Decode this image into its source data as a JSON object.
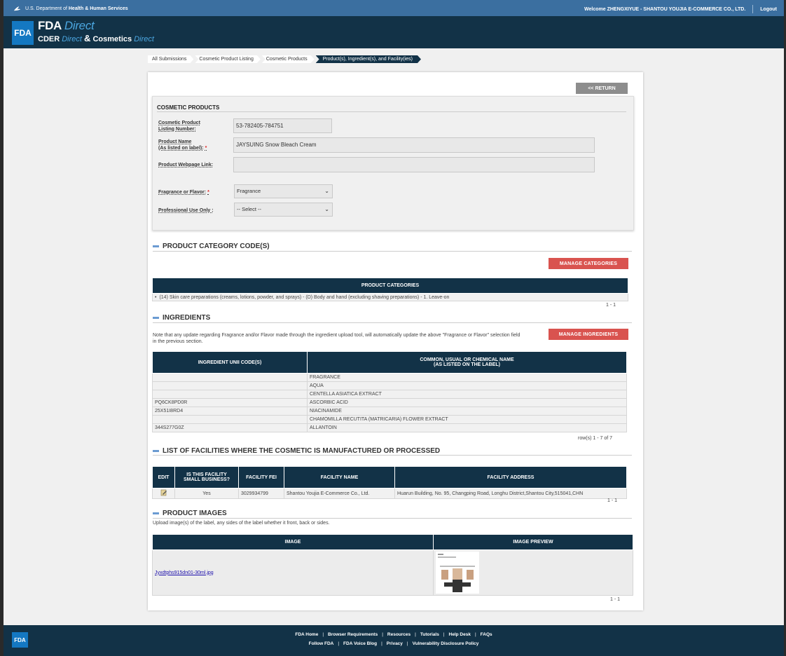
{
  "hhs_bar": {
    "department_prefix": "U.S. Department of",
    "department_name": "Health & Human Services",
    "welcome_text": "Welcome ZHENGXIYUE - SHANTOU YOUJIA E-COMMERCE CO., LTD.",
    "logout_label": "Logout"
  },
  "header": {
    "logo_text": "FDA",
    "title_main": "FDA",
    "title_direct": "Direct",
    "subtitle_cder": "CDER",
    "subtitle_direct1": "Direct",
    "subtitle_amp": "&",
    "subtitle_cosmetics": "Cosmetics",
    "subtitle_direct2": "Direct"
  },
  "breadcrumb": [
    "All Submissions",
    "Cosmetic Product Listing",
    "Cosmetic Products",
    "Product(s), Ingredient(s), and Facility(ies)"
  ],
  "return_label": "<< RETURN",
  "cosmetic_products": {
    "title": "COSMETIC PRODUCTS",
    "listing_number_label_1": "Cosmetic Product",
    "listing_number_label_2": "Listing Number:",
    "listing_number_value": "53-782405-784751",
    "product_name_label_1": "Product Name",
    "product_name_label_2": "(As listed on label):",
    "product_name_value": "JAYSUING Snow Bleach Cream",
    "webpage_label": "Product Webpage Link:",
    "webpage_value": "",
    "fragrance_label": "Fragrance or Flavor:",
    "fragrance_value": "Fragrance",
    "professional_label": "Professional Use Only :",
    "professional_value": "-- Select --",
    "required_mark": "*"
  },
  "category_section": {
    "title": "PRODUCT CATEGORY CODE(S)",
    "manage_label": "MANAGE CATEGORIES",
    "table_header": "PRODUCT CATEGORIES",
    "bullet": "•",
    "row": "(14) Skin care preparations (creams, lotions, powder, and sprays) - (D) Body and hand (excluding shaving preparations) - 1. Leave-on",
    "pager": "1 - 1"
  },
  "ingredients_section": {
    "title": "INGREDIENTS",
    "note_line1": "Note that any update regarding Fragrance and/or Flavor made through the ingredient upload tool, will automatically update the above \"Fragrance or Flavor\" selection field",
    "note_line2": "in the previous section.",
    "manage_label": "MANAGE INGREDIENTS",
    "col1": "INGREDIENT UNII CODE(S)",
    "col2_line1": "COMMON, USUAL OR CHEMICAL NAME",
    "col2_line2": "(AS LISTED ON THE LABEL)",
    "rows": [
      {
        "code": "",
        "name": "FRAGRANCE"
      },
      {
        "code": "",
        "name": "AQUA"
      },
      {
        "code": "",
        "name": "CENTELLA ASIATICA EXTRACT"
      },
      {
        "code": "PQ6CK8PD0R",
        "name": "ASCORBIC ACID"
      },
      {
        "code": "25X51I8RD4",
        "name": "NIACINAMIDE"
      },
      {
        "code": "",
        "name": "CHAMOMILLA RECUTITA (MATRICARIA) FLOWER EXTRACT"
      },
      {
        "code": "344S277G0Z",
        "name": "ALLANTOIN"
      }
    ],
    "pager": "row(s) 1 - 7 of 7"
  },
  "facilities_section": {
    "title": "LIST OF FACILITIES WHERE THE COSMETIC IS MANUFACTURED OR PROCESSED",
    "col_edit": "EDIT",
    "col_small_1": "IS THIS FACILITY",
    "col_small_2": "SMALL BUSINESS?",
    "col_fei": "FACILITY FEI",
    "col_name": "FACILITY NAME",
    "col_address": "FACILITY ADDRESS",
    "row": {
      "small_business": "Yes",
      "fei": "3029934799",
      "name": "Shantou Youjia E-Commerce Co., Ltd.",
      "address": "Huarun Building, No. 95, Changping Road, Longhu District,Shantou City,515041,CHN"
    },
    "pager": "1 - 1"
  },
  "images_section": {
    "title": "PRODUCT IMAGES",
    "note": "Upload image(s) of the label, any sides of the label whether it front, back or sides.",
    "col_image": "IMAGE",
    "col_preview": "IMAGE PREVIEW",
    "file_name": "Jyxdtphs915dn01-30ml.jpg",
    "pager": "1 - 1"
  },
  "footer": {
    "logo_text": "FDA",
    "links_row1": [
      "FDA Home",
      "Browser Requirements",
      "Resources",
      "Tutorials",
      "Help Desk",
      "FAQs"
    ],
    "links_row2": [
      "Follow FDA",
      "FDA Voice Blog",
      "Privacy",
      "Vulnerability Disclosure Policy"
    ],
    "separator": "|"
  },
  "colors": {
    "hhs_bar": "#3b6fa0",
    "navy": "#123247",
    "fda_blue": "#1478c2",
    "red_button": "#d9534f",
    "return_button": "#8d8d8d"
  }
}
